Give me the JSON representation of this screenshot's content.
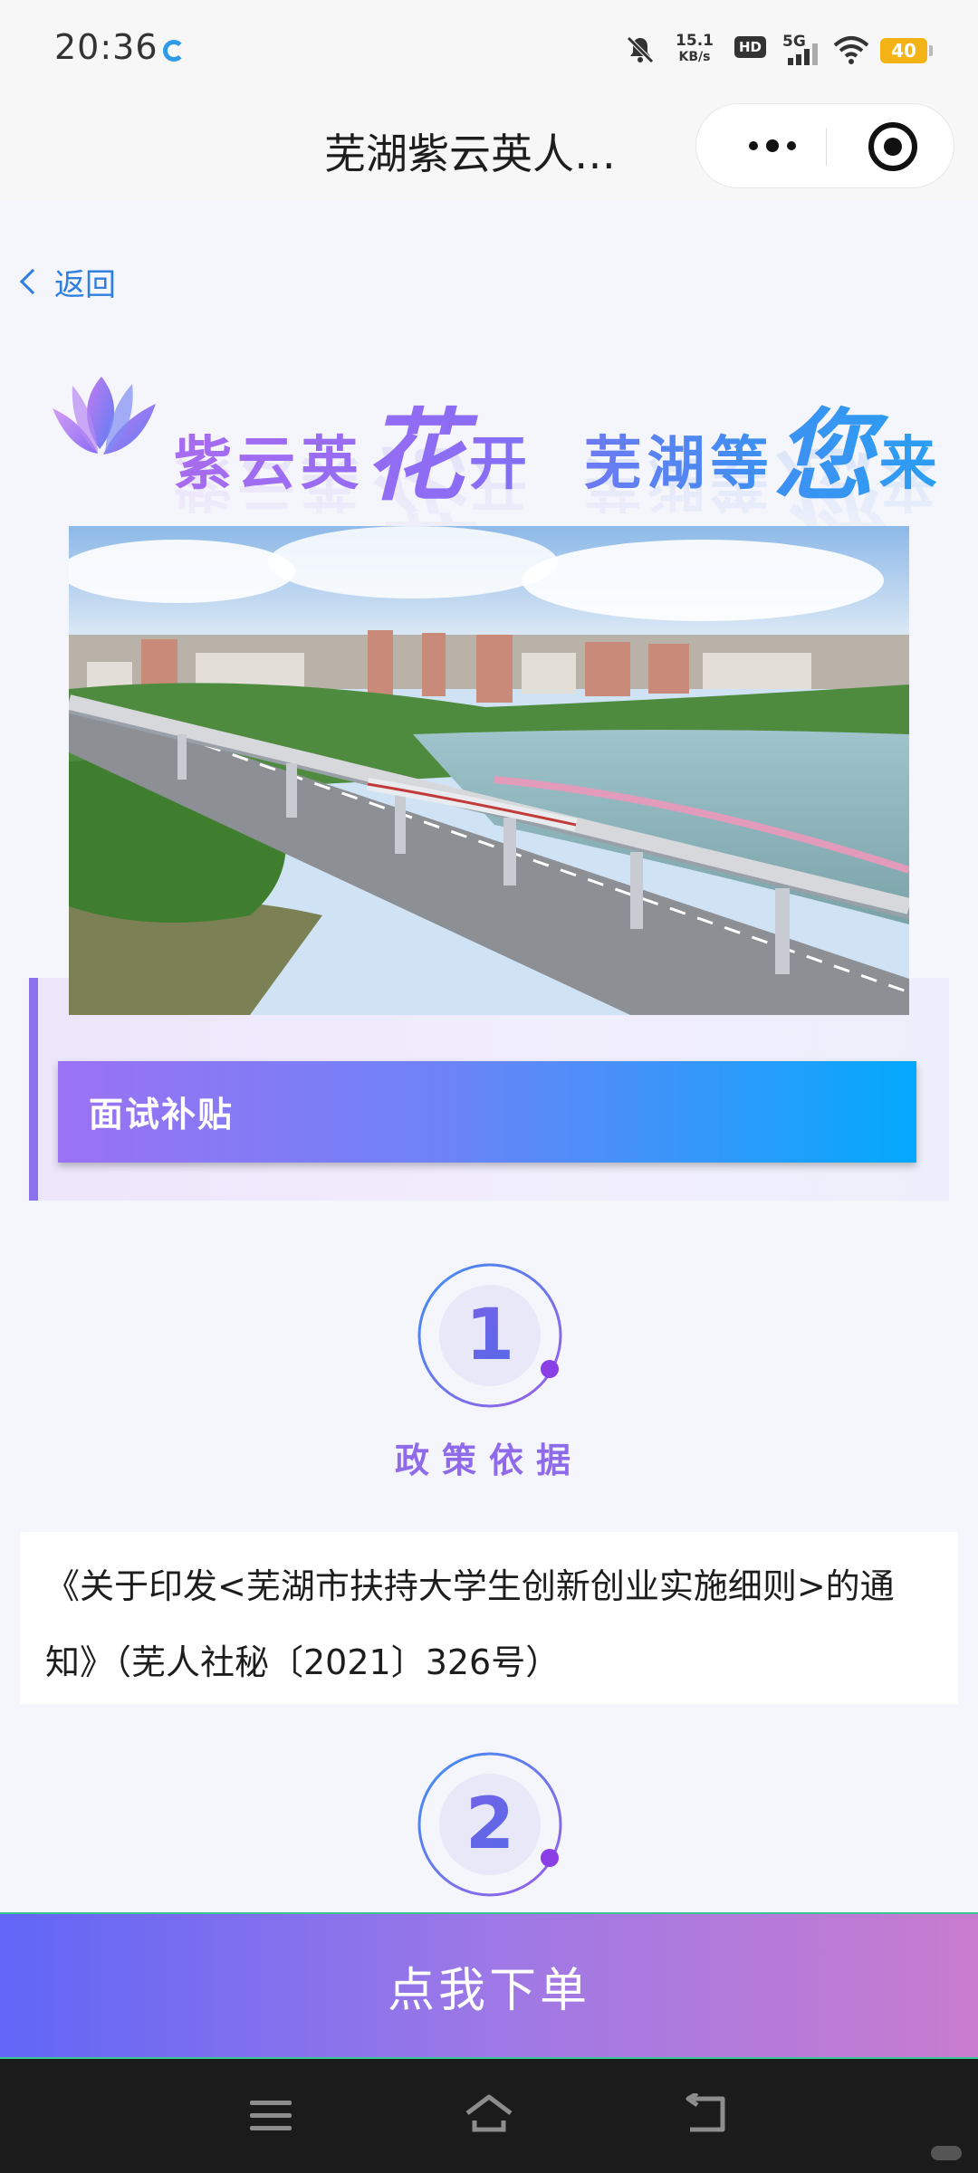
{
  "status_bar": {
    "time": "20:36",
    "net_speed_value": "15.1",
    "net_speed_unit": "KB/s",
    "hd_label": "HD",
    "network_label": "5G",
    "battery_level": "40"
  },
  "nav": {
    "title": "芜湖紫云英人…",
    "more_icon": "more-dots-icon",
    "close_icon": "target-close-icon"
  },
  "back": {
    "label": "返回"
  },
  "slogan": {
    "part1_a": "紫云英",
    "part1_big": "花",
    "part1_b": "开",
    "part2_a": "芜湖等",
    "part2_big": "您",
    "part2_b": "来"
  },
  "banner": {
    "label": "面试补贴"
  },
  "sections": [
    {
      "number": "1",
      "title": "政策依据",
      "content": "《关于印发<芜湖市扶持大学生创新创业实施细则>的通知》（芜人社秘〔2021〕326号）"
    },
    {
      "number": "2"
    }
  ],
  "order_button": {
    "label": "点我下单"
  },
  "colors": {
    "accent_purple": "#8f6bea",
    "accent_blue": "#03a9fd",
    "link_blue": "#2f7fe0"
  }
}
